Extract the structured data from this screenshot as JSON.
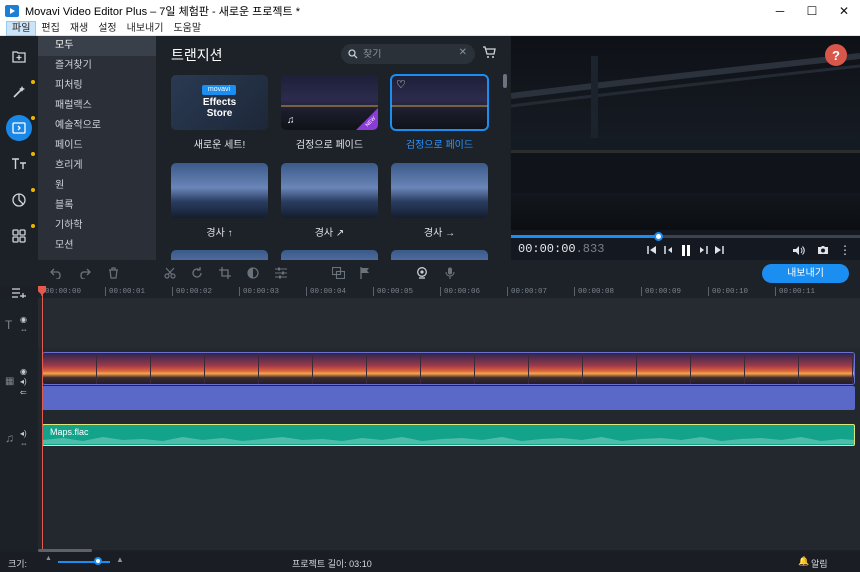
{
  "window": {
    "title": "Movavi Video Editor Plus – 7일 체험판 - 새로운 프로젝트 *",
    "minimize": "─",
    "maximize": "☐",
    "close": "✕"
  },
  "menu": [
    "파일",
    "편집",
    "재생",
    "설정",
    "내보내기",
    "도움말"
  ],
  "tools": [
    {
      "name": "import-icon",
      "glyph": "⊕"
    },
    {
      "name": "magic-wand-icon",
      "glyph": "✦"
    },
    {
      "name": "transitions-icon",
      "glyph": "◫"
    },
    {
      "name": "titles-icon",
      "glyph": "Tт"
    },
    {
      "name": "stickers-icon",
      "glyph": "◔"
    },
    {
      "name": "more-tools-icon",
      "glyph": "▦"
    }
  ],
  "categories": [
    "모두",
    "즐겨찾기",
    "피처링",
    "패럴랙스",
    "예술적으로",
    "페이드",
    "흐리게",
    "원",
    "블록",
    "기하학",
    "모션"
  ],
  "gallery": {
    "title": "트랜지션",
    "search_placeholder": "찾기",
    "store": {
      "badge": "movavi",
      "line1": "Effects",
      "line2": "Store"
    },
    "new_badge": "NEW",
    "cards": [
      "새로운 세트!",
      "검정으로 페이드",
      "검정으로 페이드",
      "경사 ↑",
      "경사 ↗",
      "경사 →"
    ]
  },
  "player": {
    "help": "?",
    "time_main": "00:00:00",
    "time_ms": ".833",
    "progress": 0.42
  },
  "timeline": {
    "export_label": "내보내기",
    "ticks": [
      "00:00:00",
      "00:00:01",
      "00:00:02",
      "00:00:03",
      "00:00:04",
      "00:00:05",
      "00:00:06",
      "00:00:07",
      "00:00:08",
      "00:00:09",
      "00:00:10",
      "00:00:11"
    ],
    "audio_clip": "Maps.flac"
  },
  "status": {
    "zoom_label": "크기:",
    "project_length": "프로젝트 길이: 03:10",
    "notifications": "알림"
  },
  "colors": {
    "accent": "#1b8ef2",
    "playhead": "#e55a4e",
    "audio": "#13a38a",
    "help": "#d9574a"
  }
}
